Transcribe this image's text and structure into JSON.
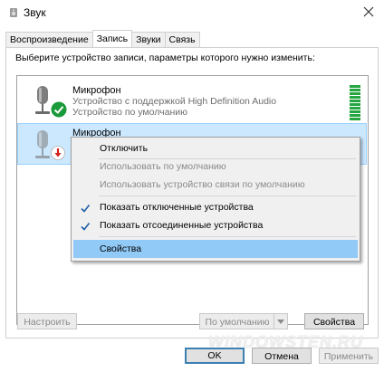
{
  "window": {
    "title": "Звук"
  },
  "tabs": [
    {
      "label": "Воспроизведение"
    },
    {
      "label": "Запись"
    },
    {
      "label": "Звуки"
    },
    {
      "label": "Связь"
    }
  ],
  "instruction": "Выберите устройство записи, параметры которого нужно изменить:",
  "devices": [
    {
      "name": "Микрофон",
      "line1": "Устройство с поддержкой High Definition Audio",
      "line2": "Устройство по умолчанию",
      "status": "default",
      "level_bars": 10
    },
    {
      "name": "Микрофон",
      "line1": "",
      "line2": "",
      "status": "disconnected"
    }
  ],
  "context_menu": {
    "items": [
      {
        "label": "Отключить",
        "enabled": true,
        "checked": false
      },
      {
        "label": "Использовать по умолчанию",
        "enabled": false,
        "checked": false
      },
      {
        "label": "Использовать устройство связи по умолчанию",
        "enabled": false,
        "checked": false
      },
      {
        "label": "Показать отключенные устройства",
        "enabled": true,
        "checked": true
      },
      {
        "label": "Показать отсоединенные устройства",
        "enabled": true,
        "checked": true
      },
      {
        "label": "Свойства",
        "enabled": true,
        "checked": false,
        "highlighted": true
      }
    ]
  },
  "buttons": {
    "configure": "Настроить",
    "set_default": "По умолчанию",
    "properties": "Свойства",
    "ok": "OK",
    "cancel": "Отмена",
    "apply": "Применить"
  },
  "watermark": "WINDOWSTEN.RU",
  "colors": {
    "selection": "#cce8ff",
    "menu_hover": "#91c9f7",
    "level": "#26a642",
    "check_badge": "#1a9a3a",
    "disconnected_badge": "#d42020"
  }
}
